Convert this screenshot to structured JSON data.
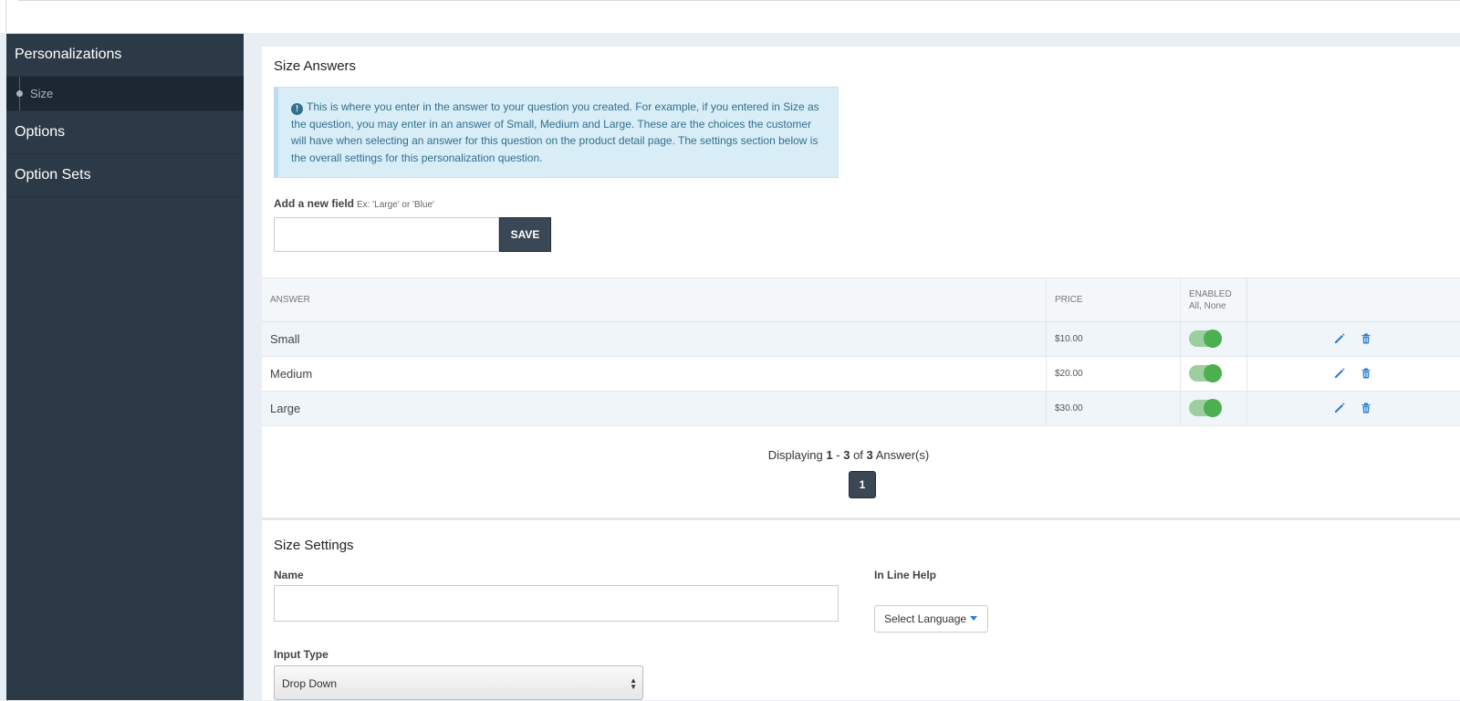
{
  "sidebar": {
    "header": "Personalizations",
    "sub_item": "Size",
    "items": [
      "Options",
      "Option Sets"
    ]
  },
  "answers": {
    "title": "Size Answers",
    "info": "This is where you enter in the answer to your question you created. For example, if you entered in Size as the question, you may enter in an answer of Small, Medium and Large. These are the choices the customer will have when selecting an answer for this question on the product detail page. The settings section below is the overall settings for this personalization question.",
    "add_label": "Add a new field",
    "add_hint": "Ex: 'Large' or 'Blue'",
    "save_label": "SAVE"
  },
  "table": {
    "headers": {
      "answer": "ANSWER",
      "price": "PRICE",
      "enabled": "ENABLED",
      "enabled_sub": "All, None"
    },
    "rows": [
      {
        "answer": "Small",
        "price": "$10.00",
        "enabled": true
      },
      {
        "answer": "Medium",
        "price": "$20.00",
        "enabled": true
      },
      {
        "answer": "Large",
        "price": "$30.00",
        "enabled": true
      }
    ]
  },
  "pager": {
    "prefix": "Displaying",
    "from": "1",
    "dash": "-",
    "to": "3",
    "of": "of",
    "total": "3",
    "suffix": "Answer(s)",
    "current_page": "1"
  },
  "settings": {
    "title": "Size Settings",
    "name_label": "Name",
    "name_value": "",
    "inline_help_label": "In Line Help",
    "language_button": "Select Language",
    "input_type_label": "Input Type",
    "input_type_value": "Drop Down"
  },
  "colors": {
    "sidebar_bg": "#2c3a47",
    "info_bg": "#d9edf7",
    "toggle_on": "#4caf50",
    "action_icon": "#2a7fd4"
  }
}
